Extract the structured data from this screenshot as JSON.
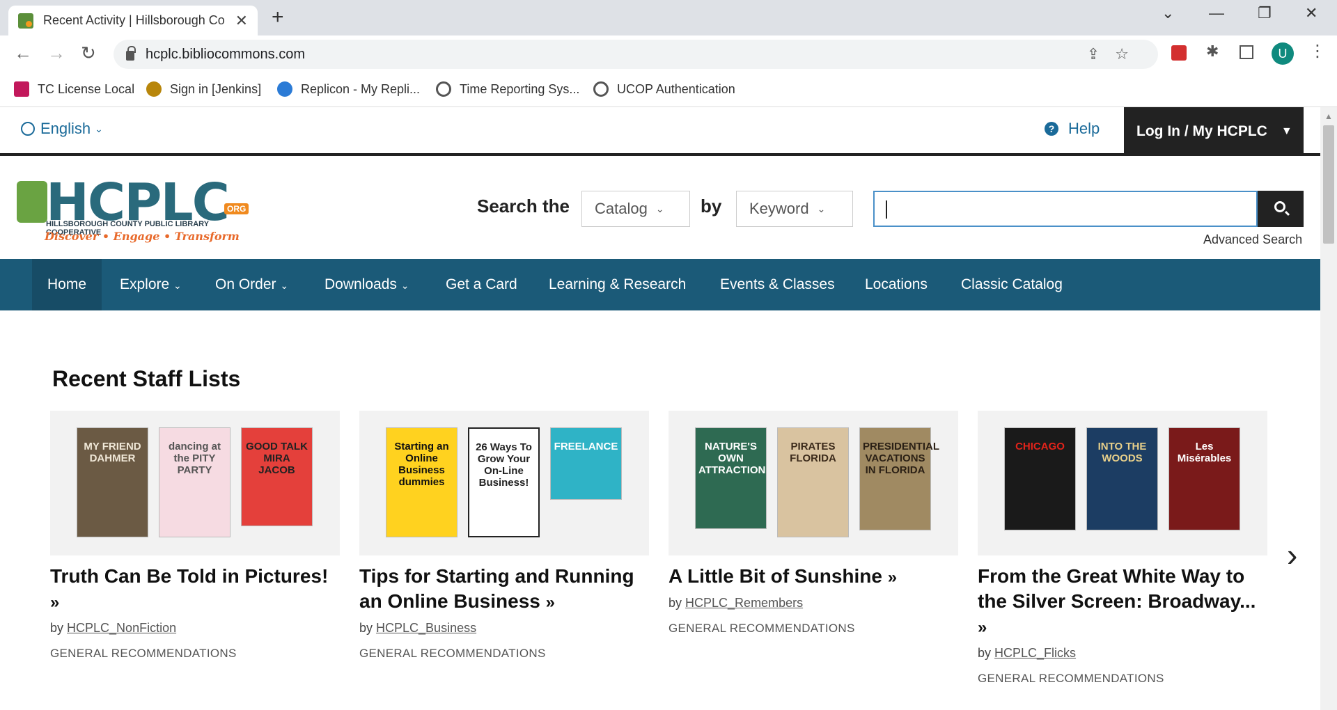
{
  "browser": {
    "tab_title": "Recent Activity | Hillsborough Co",
    "url": "hcplc.bibliocommons.com",
    "bookmarks": [
      {
        "label": "TC License Local",
        "icon": "tc-license-icon",
        "color": "#c2185b"
      },
      {
        "label": "Sign in [Jenkins]",
        "icon": "jenkins-icon",
        "color": "#b8860b"
      },
      {
        "label": "Replicon - My Repli...",
        "icon": "replicon-icon",
        "color": "#2b7bd6"
      },
      {
        "label": "Time Reporting Sys...",
        "icon": "globe-icon",
        "color": "#555555"
      },
      {
        "label": "UCOP Authentication",
        "icon": "globe-icon",
        "color": "#555555"
      }
    ],
    "profile_initial": "U"
  },
  "utility": {
    "language": "English",
    "help": "Help",
    "login": "Log In / My HCPLC"
  },
  "logo": {
    "name": "HCPLC",
    "org": "ORG",
    "subtitle": "HILLSBOROUGH COUNTY PUBLIC LIBRARY COOPERATIVE",
    "tagline": "Discover • Engage • Transform"
  },
  "search": {
    "label_search": "Search the",
    "scope": "Catalog",
    "label_by": "by",
    "field": "Keyword",
    "query": "",
    "advanced": "Advanced Search"
  },
  "nav": [
    "Home",
    "Explore",
    "On Order",
    "Downloads",
    "Get a Card",
    "Learning & Research",
    "Events & Classes",
    "Locations",
    "Classic Catalog"
  ],
  "section": {
    "title": "Recent Staff Lists"
  },
  "cards": [
    {
      "title": "Truth Can Be Told in Pictures!",
      "by": "by",
      "author": "HCPLC_NonFiction",
      "category": "GENERAL RECOMMENDATIONS",
      "books": [
        {
          "text": "MY FRIEND DAHMER",
          "bg": "#6b5a44",
          "fg": "#f0e8d8"
        },
        {
          "text": "dancing at the PITY PARTY",
          "bg": "#f6dbe2",
          "fg": "#555"
        },
        {
          "text": "GOOD TALK MIRA JACOB",
          "bg": "#e4403b",
          "fg": "#222"
        }
      ]
    },
    {
      "title": "Tips for Starting and Running an Online Business",
      "by": "by",
      "author": "HCPLC_Business",
      "category": "GENERAL RECOMMENDATIONS",
      "books": [
        {
          "text": "Starting an Online Business dummies",
          "bg": "#ffd21f",
          "fg": "#111"
        },
        {
          "text": "26 Ways To Grow Your On-Line Business!",
          "bg": "#ffffff",
          "fg": "#222"
        },
        {
          "text": "FREELANCE",
          "bg": "#2fb3c6",
          "fg": "#fff"
        }
      ]
    },
    {
      "title": "A Little Bit of Sunshine",
      "by": "by",
      "author": "HCPLC_Remembers",
      "category": "GENERAL RECOMMENDATIONS",
      "books": [
        {
          "text": "NATURE'S OWN ATTRACTION",
          "bg": "#2e6a52",
          "fg": "#fff"
        },
        {
          "text": "PIRATES FLORIDA",
          "bg": "#d9c3a0",
          "fg": "#3b2a1a"
        },
        {
          "text": "PRESIDENTIAL VACATIONS IN FLORIDA",
          "bg": "#a08a62",
          "fg": "#2b2015"
        }
      ]
    },
    {
      "title": "From the Great White Way to the Silver Screen: Broadway...",
      "by": "by",
      "author": "HCPLC_Flicks",
      "category": "GENERAL RECOMMENDATIONS",
      "books": [
        {
          "text": "CHICAGO",
          "bg": "#1a1a1a",
          "fg": "#e2231a"
        },
        {
          "text": "INTO THE WOODS",
          "bg": "#1c3d63",
          "fg": "#e8d08a"
        },
        {
          "text": "Les Misérables",
          "bg": "#7a1a1a",
          "fg": "#fff"
        }
      ]
    }
  ]
}
